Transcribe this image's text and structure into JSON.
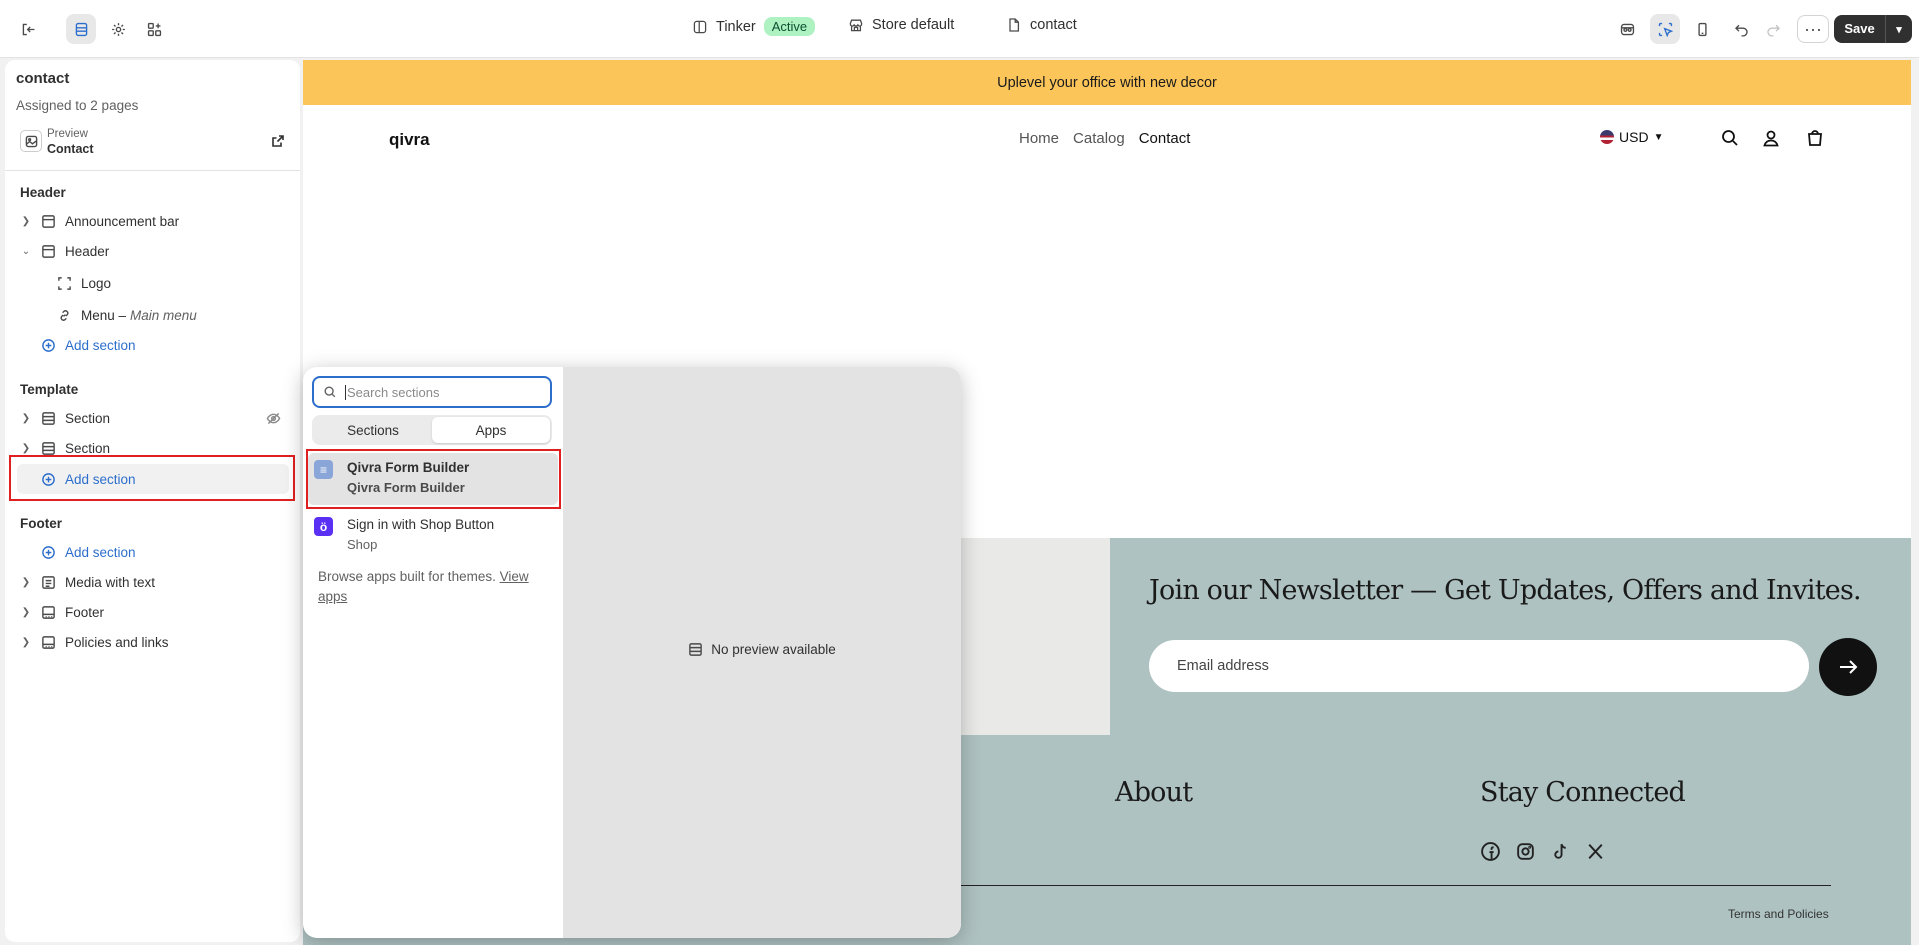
{
  "topbar": {
    "theme_name": "Tinker",
    "theme_status": "Active",
    "store": "Store default",
    "template": "contact",
    "more_label": "···",
    "save_label": "Save"
  },
  "sidebar": {
    "title": "contact",
    "assigned": "Assigned to 2 pages",
    "preview_label": "Preview",
    "preview_value": "Contact",
    "header_group": "Header",
    "header_items": [
      {
        "label": "Announcement bar"
      },
      {
        "label": "Header"
      },
      {
        "label": "Logo"
      },
      {
        "label": "Menu –",
        "suffix": "Main menu"
      },
      {
        "label": "Add section"
      }
    ],
    "template_group": "Template",
    "template_items": [
      {
        "label": "Section"
      },
      {
        "label": "Section"
      },
      {
        "label": "Add section"
      }
    ],
    "footer_group": "Footer",
    "footer_items": [
      {
        "label": "Add section"
      },
      {
        "label": "Media with text"
      },
      {
        "label": "Footer"
      },
      {
        "label": "Policies and links"
      }
    ]
  },
  "storefront": {
    "announcement": "Uplevel your office with new decor",
    "logo": "qivra",
    "nav": [
      "Home",
      "Catalog",
      "Contact"
    ],
    "currency": "USD",
    "newsletter_title": "Join our Newsletter — Get Updates, Offers and Invites.",
    "email_placeholder": "Email address",
    "footer_about": "About",
    "footer_connect": "Stay Connected",
    "terms": "Terms and Policies"
  },
  "popover": {
    "search_placeholder": "Search sections",
    "tabs": [
      "Sections",
      "Apps"
    ],
    "selected_tab": "Apps",
    "apps": [
      {
        "name": "Qivra Form Builder",
        "developer": "Qivra Form Builder"
      },
      {
        "name": "Sign in with Shop Button",
        "developer": "Shop"
      }
    ],
    "browse_text": "Browse apps built for themes.",
    "browse_link": "View apps",
    "no_preview": "No preview available"
  },
  "colors": {
    "accent": "#2c6ecb",
    "announcement_bg": "#fcc55a",
    "newsletter_bg": "#aec2c1",
    "highlight": "#e02020"
  }
}
